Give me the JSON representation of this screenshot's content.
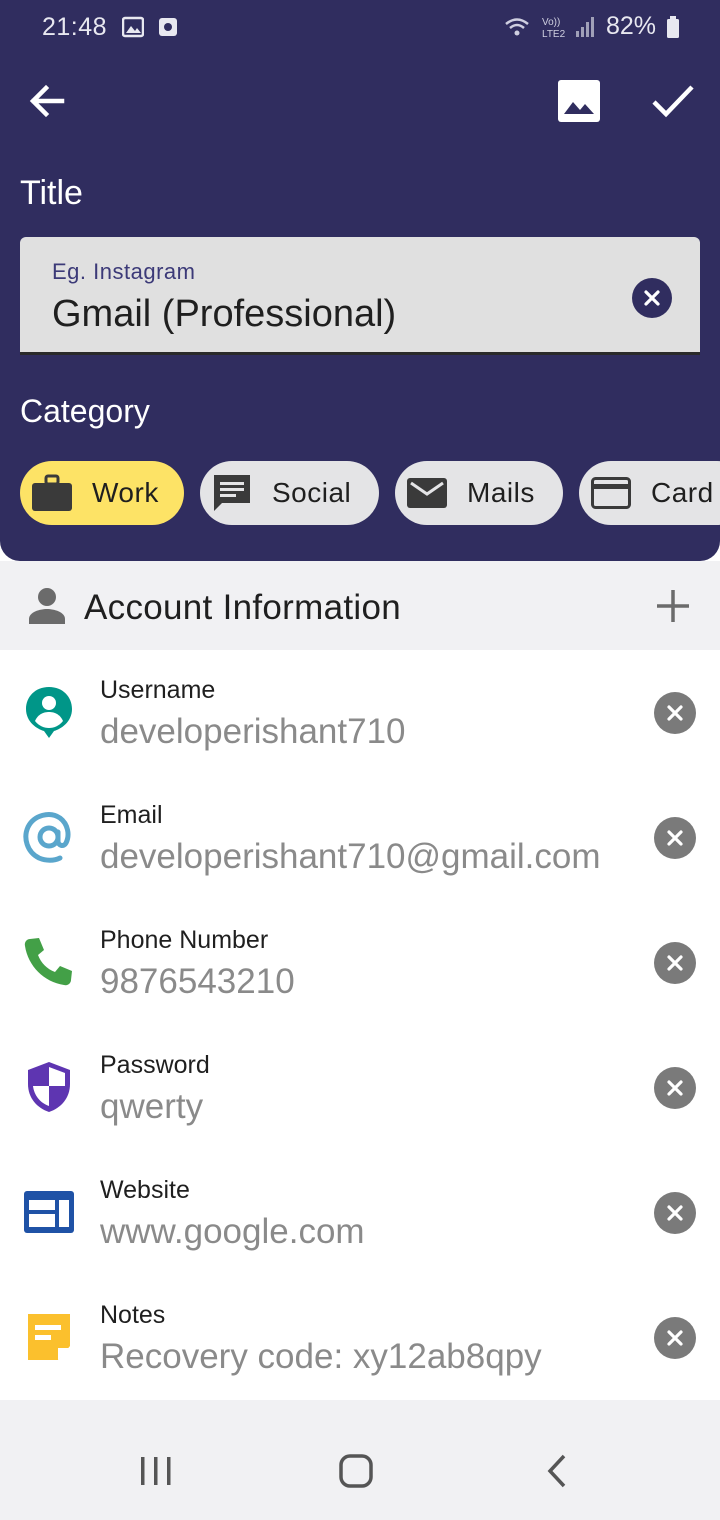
{
  "status_bar": {
    "time": "21:48",
    "battery": "82%"
  },
  "app_bar": {
    "back_icon": "arrow-left-icon",
    "image_icon": "image-icon",
    "save_icon": "check-icon"
  },
  "title_section": {
    "label": "Title",
    "field": {
      "placeholder": "Eg. Instagram",
      "value": "Gmail (Professional)"
    }
  },
  "category_section": {
    "label": "Category",
    "chips": [
      {
        "label": "Work",
        "icon": "briefcase-icon",
        "selected": true
      },
      {
        "label": "Social",
        "icon": "chat-icon",
        "selected": false
      },
      {
        "label": "Mails",
        "icon": "mail-icon",
        "selected": false
      },
      {
        "label": "Card",
        "icon": "card-icon",
        "selected": false
      }
    ]
  },
  "account_section": {
    "title": "Account Information",
    "fields": [
      {
        "label": "Username",
        "value": "developerishant710",
        "icon": "user-pin-icon"
      },
      {
        "label": "Email",
        "value": "developerishant710@gmail.com",
        "icon": "at-sign-icon"
      },
      {
        "label": "Phone Number",
        "value": "9876543210",
        "icon": "phone-icon"
      },
      {
        "label": "Password",
        "value": "qwerty",
        "icon": "shield-icon"
      },
      {
        "label": "Website",
        "value": "www.google.com",
        "icon": "web-icon"
      },
      {
        "label": "Notes",
        "value": "Recovery code: xy12ab8qpy",
        "icon": "note-icon"
      }
    ]
  },
  "colors": {
    "header_bg": "#302d5f",
    "selected_chip": "#fde366",
    "chip_bg": "#e4e4e6"
  }
}
